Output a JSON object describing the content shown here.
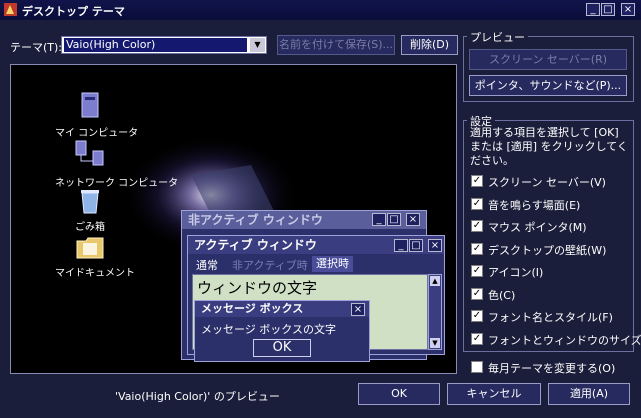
{
  "window": {
    "title": "デスクトップ テーマ",
    "minimize": "_",
    "maximize": "□",
    "close": "×"
  },
  "theme": {
    "label": "テーマ(T):",
    "selected": "Vaio(High Color)",
    "save_as_label": "名前を付けて保存(S)...",
    "delete_label": "削除(D)"
  },
  "preview_desktop": {
    "icons": [
      "マイ コンピュータ",
      "ネットワーク コンピュータ",
      "ごみ箱",
      "マイドキュメント"
    ],
    "inactive_window_title": "非アクティブ ウィンドウ",
    "active_window_title": "アクティブ ウィンドウ",
    "menu": [
      "通常",
      "非アクティブ時",
      "選択時"
    ],
    "window_text": "ウィンドウの文字",
    "messagebox_title": "メッセージ ボックス",
    "messagebox_text": "メッセージ ボックスの文字",
    "messagebox_ok": "OK"
  },
  "preview_group": {
    "title": "プレビュー",
    "screensaver_button": "スクリーン セーバー(R)",
    "pointer_sound_button": "ポインタ、サウンドなど(P)..."
  },
  "settings_group": {
    "title": "設定",
    "description": "適用する項目を選択して [OK] または [適用] をクリックしてください。",
    "items": [
      {
        "label": "スクリーン セーバー(V)",
        "checked": true
      },
      {
        "label": "音を鳴らす場面(E)",
        "checked": true
      },
      {
        "label": "マウス ポインタ(M)",
        "checked": true
      },
      {
        "label": "デスクトップの壁紙(W)",
        "checked": true
      },
      {
        "label": "アイコン(I)",
        "checked": true
      },
      {
        "label": "色(C)",
        "checked": true
      },
      {
        "label": "フォント名とスタイル(F)",
        "checked": true
      },
      {
        "label": "フォントとウィンドウのサイズ(Z)",
        "checked": true
      }
    ]
  },
  "monthly_change": {
    "label": "毎月テーマを変更する(O)",
    "checked": false
  },
  "status_caption": "'Vaio(High Color)' のプレビュー",
  "buttons": {
    "ok": "OK",
    "cancel": "キャンセル",
    "apply": "適用(A)"
  },
  "colors": {
    "background": "#1b1e3a",
    "titlebar": "#0a0d3a",
    "selection": "#14186e"
  }
}
